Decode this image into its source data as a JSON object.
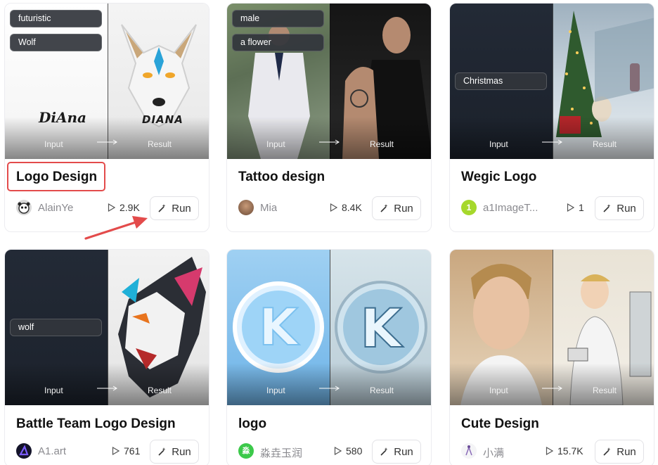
{
  "preview_labels": {
    "input": "Input",
    "result": "Result"
  },
  "run_label": "Run",
  "colors": {
    "highlight": "#e34b4b",
    "border": "#ececf0"
  },
  "cards": [
    {
      "title": "Logo Design",
      "author": "AlainYe",
      "runs": "2.9K",
      "tags": [
        "futuristic",
        "Wolf"
      ],
      "input_text": "DiAna",
      "result_text": "DIANA"
    },
    {
      "title": "Tattoo design",
      "author": "Mia",
      "runs": "8.4K",
      "tags": [
        "male",
        "a flower"
      ]
    },
    {
      "title": "Wegic Logo",
      "author": "a1ImageT...",
      "runs": "1",
      "tags": [
        "Christmas"
      ],
      "avatar_text": "1"
    },
    {
      "title": "Battle Team Logo Design",
      "author": "A1.art",
      "runs": "761",
      "tags": [
        "wolf"
      ]
    },
    {
      "title": "logo",
      "author": "淼垚玉润",
      "runs": "580",
      "tags": [],
      "avatar_text": "淼"
    },
    {
      "title": "Cute Design",
      "author": "小满",
      "runs": "15.7K",
      "tags": []
    }
  ]
}
